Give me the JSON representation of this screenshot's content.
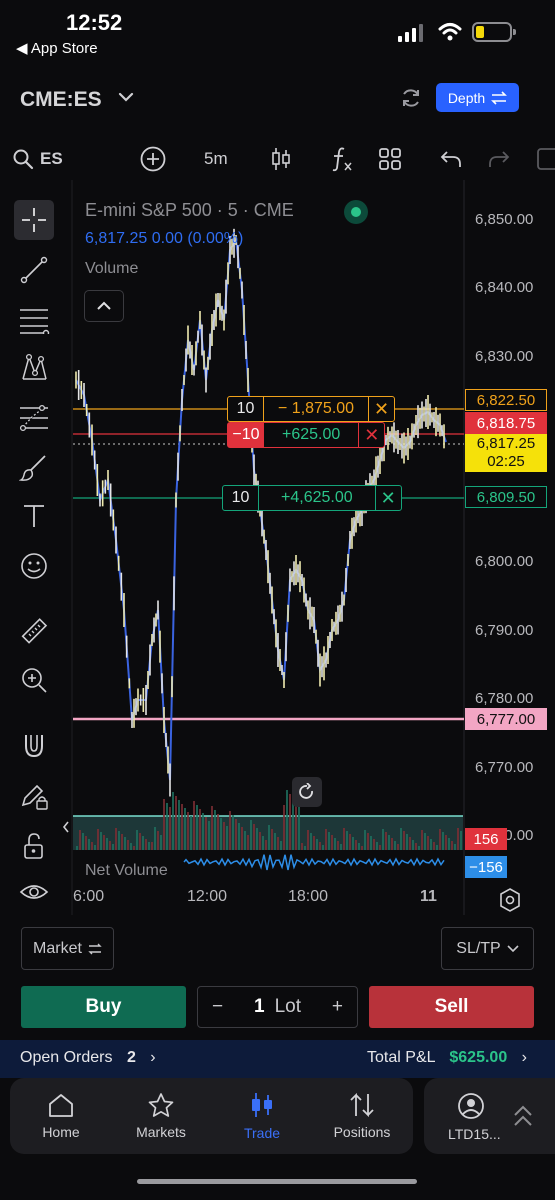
{
  "status": {
    "time": "12:52",
    "back_label": "◀ App Store"
  },
  "header": {
    "symbol": "CME:ES",
    "depth_label": "Depth"
  },
  "toolbar": {
    "search_label": "ES",
    "interval": "5m"
  },
  "legend": {
    "title": "E-mini S&P 500 · 5 · CME",
    "price_line": "6,817.25  0.00 (0.00%)",
    "volume_label": "Volume",
    "net_volume_label": "Net Volume"
  },
  "price_axis": [
    "6,850.00",
    "6,840.00",
    "6,830.00",
    "6,800.00",
    "6,790.00",
    "6,780.00",
    "6,770.00",
    "6,760.00"
  ],
  "time_axis": [
    "6:00",
    "12:00",
    "18:00",
    "11"
  ],
  "price_tags": {
    "order_upper": "6,822.50",
    "order_mid": "6,818.75",
    "last_price": "6,817.25",
    "countdown": "02:25",
    "position": "6,809.50",
    "alert": "6,777.00",
    "volume_value": "156",
    "net_volume_value": "−156"
  },
  "orders": [
    {
      "qty": "10",
      "pnl": "− 1,875.00",
      "close": "✕"
    },
    {
      "qty": "−10",
      "pnl": "+625.00",
      "close": "✕"
    },
    {
      "qty": "10",
      "pnl": "+4,625.00",
      "close": "✕"
    }
  ],
  "order_panel": {
    "order_type": "Market",
    "sltp": "SL/TP",
    "buy": "Buy",
    "sell": "Sell",
    "minus": "−",
    "plus": "+",
    "qty": "1",
    "unit": "Lot"
  },
  "orders_bar": {
    "open_orders_label": "Open Orders",
    "open_orders_count": "2",
    "total_pnl_label": "Total P&L",
    "total_pnl": "$625.00"
  },
  "nav": [
    {
      "label": "Home",
      "icon": "home-icon"
    },
    {
      "label": "Markets",
      "icon": "star-icon"
    },
    {
      "label": "Trade",
      "icon": "candles-icon"
    },
    {
      "label": "Positions",
      "icon": "swap-icon"
    }
  ],
  "account": {
    "label": "LTD15..."
  },
  "colors": {
    "accent": "#2962ff",
    "green": "#2bc48a",
    "red": "#e0323c",
    "orange": "#f0a21b",
    "yellow_tag": "#f5e10a",
    "pink_line": "#f3a6c4"
  }
}
